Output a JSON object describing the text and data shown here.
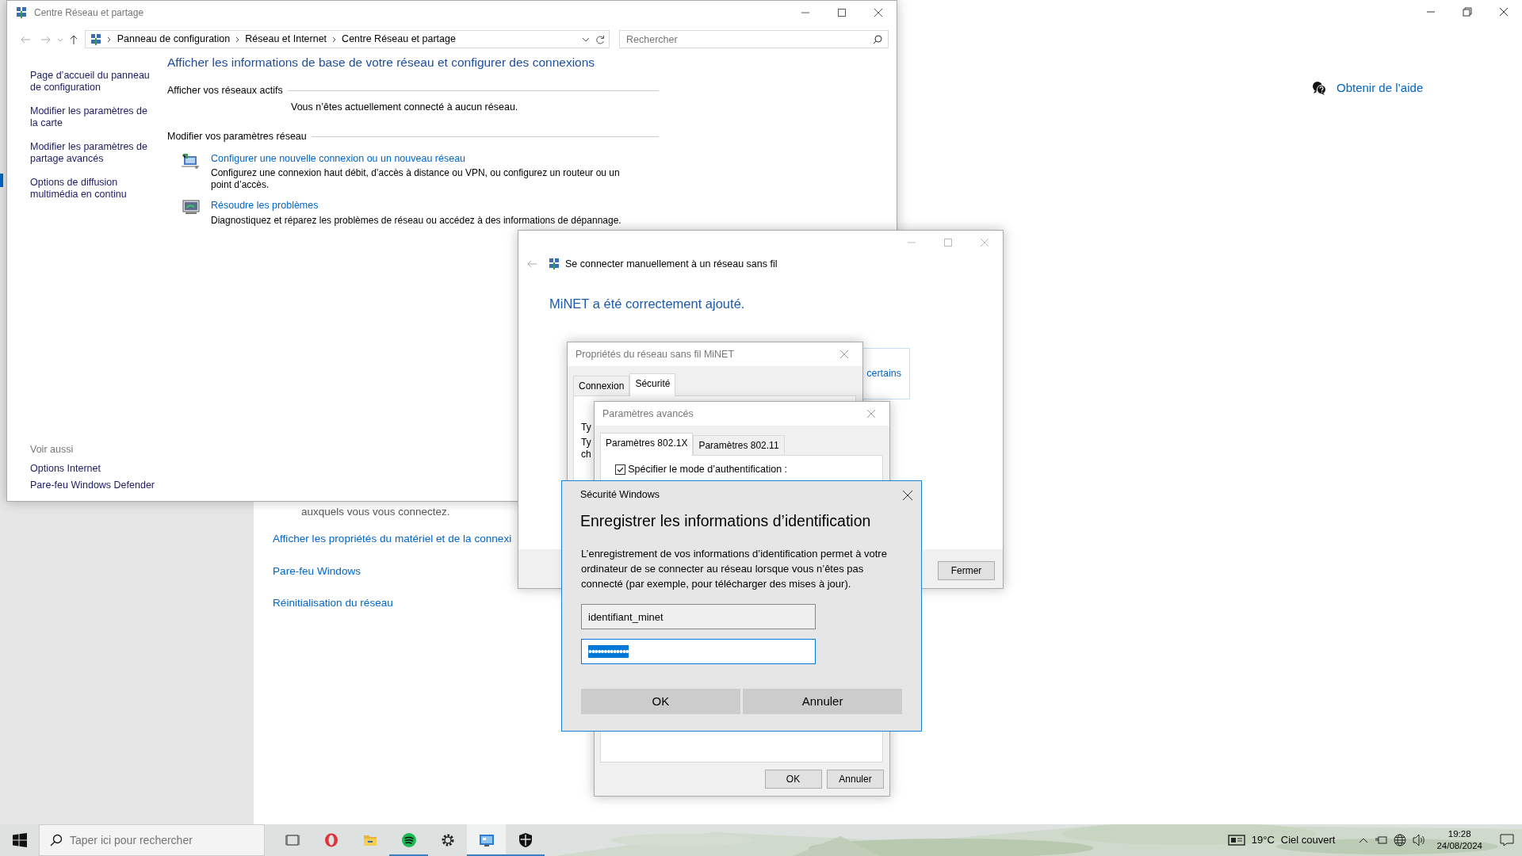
{
  "settings_window": {
    "help_link": "Obtenir de l’aide",
    "partial_text": "auxquels vous vous connectez.",
    "links": [
      "Afficher les propriétés du matériel et de la connexi",
      "Pare-feu Windows",
      "Réinitialisation du réseau"
    ]
  },
  "control_panel": {
    "title": "Centre Réseau et partage",
    "breadcrumb": [
      "Panneau de configuration",
      "Réseau et Internet",
      "Centre Réseau et partage"
    ],
    "search": {
      "placeholder": "Rechercher"
    },
    "sidebar": [
      "Page d’accueil du panneau de configuration",
      "Modifier les paramètres de la carte",
      "Modifier les paramètres de partage avancés",
      "Options de diffusion multimédia en continu"
    ],
    "see_also": {
      "heading": "Voir aussi",
      "links": [
        "Options Internet",
        "Pare-feu Windows Defender"
      ]
    },
    "heading": "Afficher les informations de base de votre réseau et configurer des connexions",
    "sections": [
      {
        "title": "Afficher vos réseaux actifs",
        "text": "Vous n’êtes actuellement connecté à aucun réseau."
      },
      {
        "title": "Modifier vos paramètres réseau",
        "tasks": [
          {
            "kind": "setup",
            "link": "Configurer une nouvelle connexion ou un nouveau réseau",
            "description": "Configurez une connexion haut débit, d’accès à distance ou VPN, ou configurez un routeur ou un point d’accès."
          },
          {
            "kind": "troubleshoot",
            "link": "Résoudre les problèmes",
            "description": "Diagnostiquez et réparez les problèmes de réseau ou accédez à des informations de dépannage."
          }
        ]
      }
    ]
  },
  "connect_window": {
    "title": "Se connecter manuellement à un réseau sans fil",
    "message": "MiNET a été correctement ajouté.",
    "partial_link": "certains",
    "buttons": [
      "Fermer"
    ]
  },
  "properties_dialog": {
    "title": "Propriétés du réseau sans fil MiNET",
    "tabs": [
      {
        "label": "Connexion",
        "selected": false
      },
      {
        "label": "Sécurité",
        "selected": true
      }
    ],
    "partial_labels": [
      "Ty",
      "Ty",
      "ch"
    ]
  },
  "advanced_dialog": {
    "title": "Paramètres avancés",
    "tabs": [
      {
        "label": "Paramètres 802.1X",
        "selected": true
      },
      {
        "label": "Paramètres 802.11",
        "selected": false
      }
    ],
    "checkbox": {
      "label": "Spécifier le mode d’authentification :",
      "checked": true
    },
    "buttons": [
      "OK",
      "Annuler"
    ]
  },
  "security_dialog": {
    "app_title": "Sécurité Windows",
    "heading": "Enregistrer les informations d’identification",
    "message": "L’enregistrement de vos informations d’identification permet à votre ordinateur de se connecter au réseau lorsque vous n’êtes pas connecté (par exemple, pour télécharger des mises à jour).",
    "username": {
      "value": "identifiant_minet"
    },
    "password": {
      "value": "•••••••••••••",
      "text_selected": true
    },
    "buttons": [
      "OK",
      "Annuler"
    ]
  },
  "taskbar": {
    "search": {
      "placeholder": "Taper ici pour rechercher"
    },
    "apps": [
      {
        "kind": "taskview",
        "running": false,
        "selected": false
      },
      {
        "kind": "opera",
        "running": false,
        "selected": false
      },
      {
        "kind": "folder",
        "running": false,
        "selected": false
      },
      {
        "kind": "spotify",
        "running": true,
        "selected": false
      },
      {
        "kind": "gear",
        "running": false,
        "selected": false
      },
      {
        "kind": "panel",
        "running": true,
        "selected": true
      },
      {
        "kind": "shield",
        "running": true,
        "selected": false
      }
    ],
    "weather": {
      "temperature": "19°C",
      "condition": "Ciel couvert"
    },
    "clock": {
      "time": "19:28",
      "date": "24/08/2024"
    }
  }
}
